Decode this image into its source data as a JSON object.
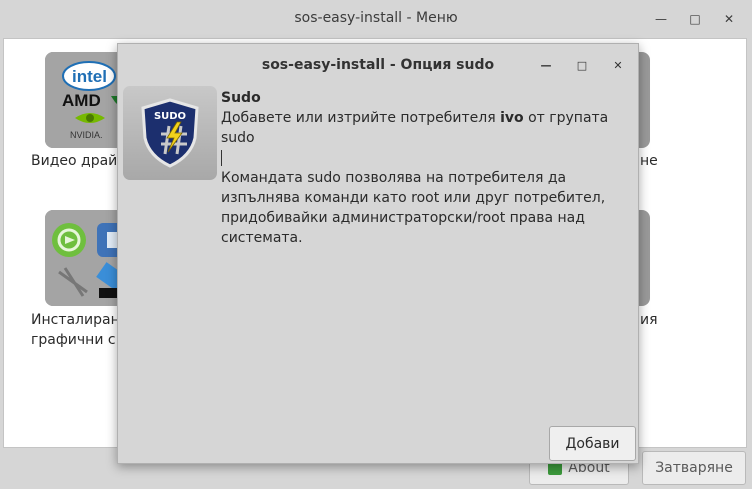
{
  "main_window": {
    "title": "sos-easy-install - Меню",
    "controls": [
      "minimize",
      "maximize",
      "close"
    ],
    "tiles": [
      {
        "label": "Видео драй",
        "icon": "intel-amd-nvidia-icon"
      },
      {
        "label": "Инсталиран",
        "label2": "графични с",
        "icon": "graphics-apps-icon"
      }
    ],
    "right_fragments": [
      "не",
      "ия"
    ],
    "buttons": {
      "about": "About",
      "close": "Затваряне"
    }
  },
  "dialog": {
    "title": "sos-easy-install - Опция sudo",
    "heading": "Sudo",
    "line1_before": "Добавете или изтрийте потребителя ",
    "user": "ivo",
    "line1_after": " от групата sudo",
    "description": "Командата sudo позволява на потребителя да изпълнява команди като root или друг потребител, придобивайки администраторски/root права над системата.",
    "icon_text": "SUDO",
    "add_button": "Добави"
  },
  "colors": {
    "window_bg": "#d6d6d6",
    "body_bg": "#ffffff",
    "shield": "#1c2f6e"
  }
}
